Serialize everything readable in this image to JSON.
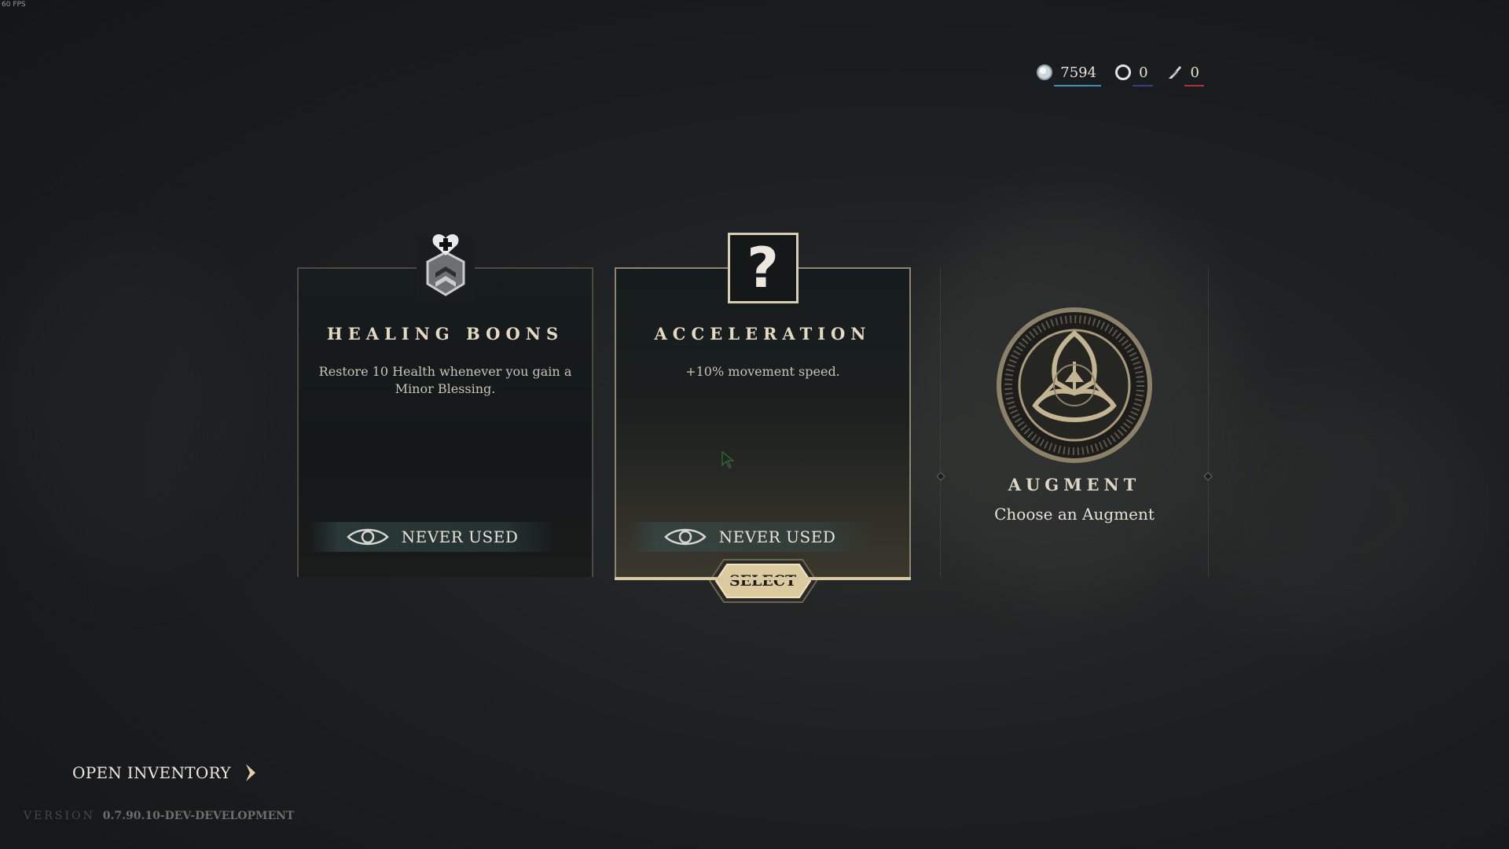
{
  "overlay": {
    "fps": "60 FPS"
  },
  "currencies": [
    {
      "icon": "spirit-orb-icon",
      "value": "7594",
      "underline_color": "#3f8fb3"
    },
    {
      "icon": "ring-icon",
      "value": "0",
      "underline_color": "#3a3f7a"
    },
    {
      "icon": "feather-scroll-icon",
      "value": "0",
      "underline_color": "#b33232"
    }
  ],
  "cards": [
    {
      "icon": "healing-shield-icon",
      "title": "HEALING BOONS",
      "description": "Restore 10 Health whenever you gain a Minor Blessing.",
      "usage_icon": "eye-icon",
      "usage_label": "NEVER USED",
      "selected": false
    },
    {
      "icon": "question-mark-icon",
      "icon_glyph": "?",
      "title": "ACCELERATION",
      "description": "+10% movement speed.",
      "usage_icon": "eye-icon",
      "usage_label": "NEVER USED",
      "selected": true,
      "select_label": "SELECT"
    }
  ],
  "augment": {
    "icon": "augment-emblem-icon",
    "title": "AUGMENT",
    "subtitle": "Choose an Augment"
  },
  "footer": {
    "open_inventory_label": "OPEN INVENTORY",
    "version_key": "VERSION",
    "version_value": "0.7.90.10-DEV-DEVELOPMENT"
  },
  "colors": {
    "accent_gold": "#d9c9a3",
    "card_border": "#4f4a3f",
    "background": "#1d2022"
  }
}
